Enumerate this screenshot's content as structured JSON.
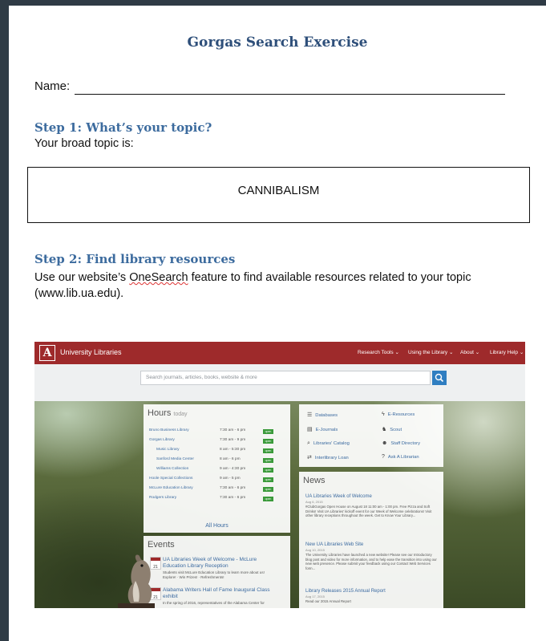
{
  "doc": {
    "title": "Gorgas Search Exercise",
    "name_label": "Name:",
    "step1": {
      "heading": "Step 1: What’s your topic?",
      "prompt": "Your broad topic is:",
      "topic": "CANNIBALISM"
    },
    "step2": {
      "heading": "Step 2: Find library resources",
      "text_before": "Use our website’s ",
      "text_link": "OneSearch",
      "text_after": " feature to find available resources related to your topic",
      "text_line2": "(www.lib.ua.edu)."
    }
  },
  "site": {
    "logo_letter": "A",
    "logo_text": "University Libraries",
    "nav": [
      "Research Tools ⌄",
      "Using the Library ⌄",
      "About ⌄",
      "Library Help ⌄"
    ],
    "search_placeholder": "Search journals, articles, books, website & more",
    "hours": {
      "title": "Hours",
      "subtitle": "today",
      "rows": [
        {
          "name": "Bruno Business Library",
          "time": "7:30 am - 6 pm"
        },
        {
          "name": "Gorgas Library",
          "time": "7:30 am - 9 pm"
        },
        {
          "name": "Music Library",
          "time": "8 am - 5:30 pm"
        },
        {
          "name": "Sanford Media Center",
          "time": "8 am - 6 pm"
        },
        {
          "name": "Williams Collection",
          "time": "9 am - 4:30 pm"
        },
        {
          "name": "Hoole Special Collections",
          "time": "9 am - 5 pm"
        },
        {
          "name": "McLure Education Library",
          "time": "7:30 am - 6 pm"
        },
        {
          "name": "Rodgers Library",
          "time": "7:30 am - 6 pm"
        }
      ],
      "open_label": "open",
      "all_hours": "All Hours"
    },
    "events": {
      "title": "Events",
      "items": [
        {
          "day": "21",
          "title": "UA Libraries Week of Welcome - McLure Education Library Reception",
          "desc": "Students visit McLure Education Library to learn more about us! Explore! · Win Prizes! · Refreshments!"
        },
        {
          "day": "21",
          "title": "Alabama Writers Hall of Fame Inaugural Class exhibit",
          "desc": "In the spring of 2016, representatives of the Alabama Center for"
        }
      ]
    },
    "resources": [
      {
        "icon": "database-icon",
        "glyph": "☰",
        "label": "Databases"
      },
      {
        "icon": "eresources-icon",
        "glyph": "ϟ",
        "label": "E-Resources"
      },
      {
        "icon": "ejournals-icon",
        "glyph": "▤",
        "label": "E-Journals"
      },
      {
        "icon": "scout-icon",
        "glyph": "♞",
        "label": "Scout"
      },
      {
        "icon": "catalog-search-icon",
        "glyph": "⌕",
        "label": "Libraries' Catalog"
      },
      {
        "icon": "staff-icon",
        "glyph": "☻",
        "label": "Staff Directory"
      },
      {
        "icon": "interlibrary-icon",
        "glyph": "⇄",
        "label": "Interlibrary Loan"
      },
      {
        "icon": "ask-icon",
        "glyph": "?",
        "label": "Ask A Librarian"
      }
    ],
    "news": {
      "title": "News",
      "items": [
        {
          "title": "UA Libraries Week of Welcome",
          "date": "Aug 6, 2015",
          "text": "#ClubGorgas Open House on August 18 11:00 am - 1:00 pm. Free Pizza and Soft Drinks! Visit UA Libraries' kickoff event for our Week of Welcome celebrations! Visit other library receptions throughout the week. Get to Know Your Library..."
        },
        {
          "title": "New UA Libraries Web Site",
          "date": "Aug 10, 2015",
          "text": "The University Libraries have launched a new website! Please see our Introductory blog post and video for more information, and to help ease the transition into using our new web presence. Please submit your feedback using our Contact Web Services form..."
        },
        {
          "title": "Library Releases 2015 Annual Report",
          "date": "Aug 17, 2015",
          "text": "Read our 2015 Annual Report"
        }
      ]
    },
    "colors": {
      "crimson": "#9e2a2b",
      "link": "#3b6aa0",
      "open": "#3a9a3a",
      "search_button": "#2f7ec1"
    }
  }
}
